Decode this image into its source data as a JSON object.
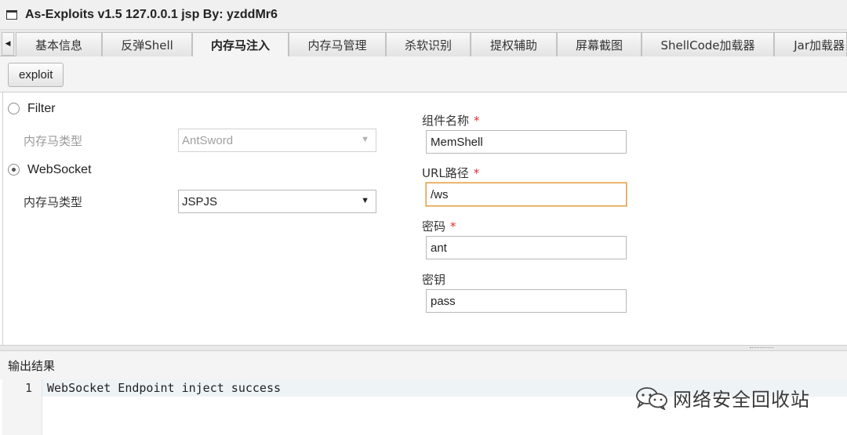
{
  "window": {
    "title": "As-Exploits v1.5 127.0.0.1 jsp By: yzddMr6"
  },
  "tabs": [
    {
      "label": "基本信息"
    },
    {
      "label": "反弹Shell"
    },
    {
      "label": "内存马注入"
    },
    {
      "label": "内存马管理"
    },
    {
      "label": "杀软识别"
    },
    {
      "label": "提权辅助"
    },
    {
      "label": "屏幕截图"
    },
    {
      "label": "ShellCode加载器"
    },
    {
      "label": "Jar加载器"
    }
  ],
  "active_tab": "内存马注入",
  "toolbar": {
    "exploit_label": "exploit"
  },
  "filter": {
    "radio_label": "Filter",
    "checked": false,
    "type_label": "内存马类型",
    "type_value": "AntSword"
  },
  "websocket": {
    "radio_label": "WebSocket",
    "checked": true,
    "type_label": "内存马类型",
    "type_value": "JSPJS"
  },
  "form": {
    "component_name": {
      "label": "组件名称",
      "required_mark": "*",
      "value": "MemShell"
    },
    "url_path": {
      "label": "URL路径",
      "required_mark": "*",
      "value": "/ws"
    },
    "password": {
      "label": "密码",
      "required_mark": "*",
      "value": "ant"
    },
    "secret_key": {
      "label": "密钥",
      "value": "pass"
    }
  },
  "output": {
    "header": "输出结果",
    "lines": [
      {
        "number": "1",
        "text": "WebSocket Endpoint inject success"
      }
    ]
  },
  "watermark": {
    "text": "网络安全回收站",
    "icon": "wechat-icon"
  }
}
